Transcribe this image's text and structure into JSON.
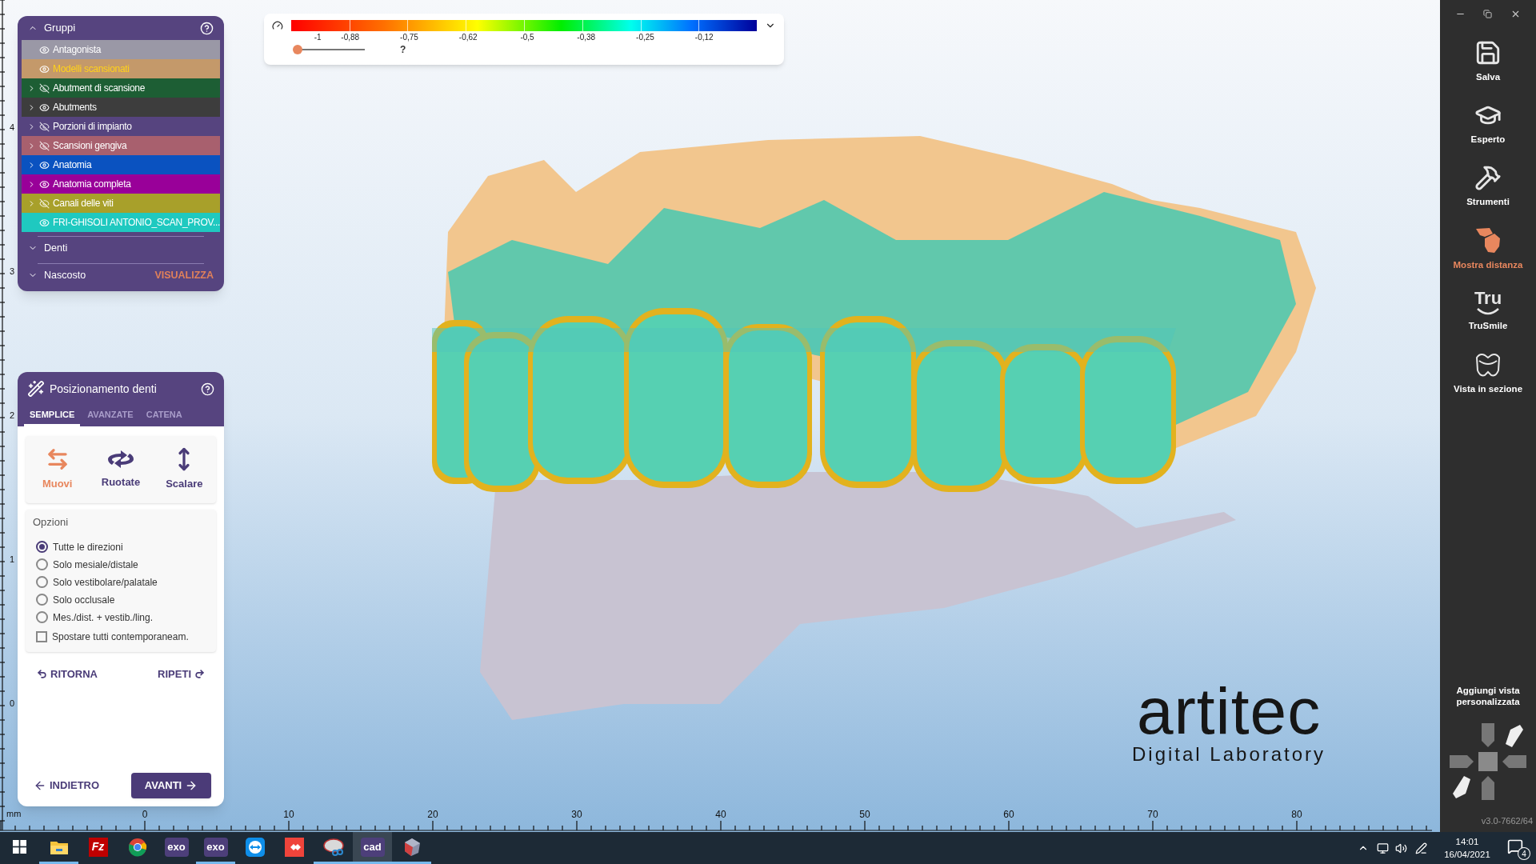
{
  "groups_panel": {
    "title": "Gruppi",
    "expanded": true,
    "items": [
      {
        "label": "Antagonista",
        "visible": true,
        "has_children": false,
        "active": false,
        "color": "#9a98a6"
      },
      {
        "label": "Modelli scansionati",
        "visible": true,
        "has_children": false,
        "active": true,
        "color": "#c4996a"
      },
      {
        "label": "Abutment di scansione",
        "visible": false,
        "has_children": true,
        "active": false,
        "color": "#1d5e34"
      },
      {
        "label": "Abutments",
        "visible": true,
        "has_children": true,
        "active": false,
        "color": "#3d3d3d"
      },
      {
        "label": "Porzioni di impianto",
        "visible": false,
        "has_children": true,
        "active": false,
        "color": "#56447f"
      },
      {
        "label": "Scansioni gengiva",
        "visible": false,
        "has_children": true,
        "active": false,
        "color": "#a8606e"
      },
      {
        "label": "Anatomia",
        "visible": true,
        "has_children": true,
        "active": false,
        "color": "#0a52c0"
      },
      {
        "label": "Anatomia completa",
        "visible": true,
        "has_children": true,
        "active": false,
        "color": "#990099"
      },
      {
        "label": "Canali delle viti",
        "visible": false,
        "has_children": true,
        "active": false,
        "color": "#a8a02a"
      },
      {
        "label": "FRI-GHISOLI ANTONIO_SCAN_PROV...",
        "visible": true,
        "has_children": false,
        "active": false,
        "color": "#1fc9c0"
      }
    ],
    "sections": [
      {
        "label": "Denti",
        "expanded": false
      },
      {
        "label": "Nascosto",
        "expanded": false,
        "action": "VISUALIZZA"
      }
    ]
  },
  "color_scale": {
    "ticks": [
      "-1",
      "-0,88",
      "-0,75",
      "-0,62",
      "-0,5",
      "-0,38",
      "-0,25",
      "-0,12"
    ],
    "slider": {
      "level": 0
    },
    "help": "?"
  },
  "positioning_panel": {
    "title": "Posizionamento denti",
    "tabs": [
      {
        "label": "SEMPLICE",
        "selected": true
      },
      {
        "label": "AVANZATE",
        "selected": false
      },
      {
        "label": "CATENA",
        "selected": false
      }
    ],
    "tools": [
      {
        "label": "Muovi",
        "kind": "move",
        "selected": true
      },
      {
        "label": "Ruotate",
        "kind": "rotate",
        "selected": false
      },
      {
        "label": "Scalare",
        "kind": "scale",
        "selected": false
      }
    ],
    "options": {
      "title": "Opzioni",
      "radios": [
        {
          "label": "Tutte le direzioni",
          "selected": true
        },
        {
          "label": "Solo mesiale/distale",
          "selected": false
        },
        {
          "label": "Solo vestibolare/palatale",
          "selected": false
        },
        {
          "label": "Solo occlusale",
          "selected": false
        },
        {
          "label": "Mes./dist. + vestib./ling.",
          "selected": false
        }
      ],
      "checkbox": {
        "label": "Spostare tutti contemporaneam.",
        "checked": false
      }
    },
    "undo": "RITORNA",
    "redo": "RIPETI",
    "back": "INDIETRO",
    "next": "AVANTI"
  },
  "rulers": {
    "vertical": [
      "4",
      "3",
      "2",
      "1",
      "0"
    ],
    "unit": "mm",
    "horizontal": [
      "0",
      "10",
      "20",
      "30",
      "40",
      "50",
      "60",
      "70",
      "80"
    ]
  },
  "logo": {
    "brand": "artitec",
    "tagline": "Digital Laboratory"
  },
  "sidebar": {
    "items": [
      {
        "label": "Salva",
        "kind": "save",
        "selected": false
      },
      {
        "label": "Esperto",
        "kind": "expert",
        "selected": false
      },
      {
        "label": "Strumenti",
        "kind": "tools",
        "selected": false
      },
      {
        "label": "Mostra distanza",
        "kind": "distance",
        "selected": true
      },
      {
        "label": "TruSmile",
        "kind": "trusmile",
        "icon_text": "Tru",
        "selected": false
      },
      {
        "label": "Vista in sezione",
        "kind": "section",
        "selected": false
      }
    ],
    "custom_view": "Aggiungi vista personalizzata",
    "version": "v3.0-7662/64"
  },
  "taskbar": {
    "apps": [
      {
        "kind": "start",
        "running": false,
        "selected": false
      },
      {
        "kind": "folder",
        "running": true,
        "selected": false
      },
      {
        "kind": "filezilla",
        "label": "Fz",
        "running": false,
        "selected": false
      },
      {
        "kind": "chrome",
        "running": false,
        "selected": false
      },
      {
        "kind": "exo",
        "label": "exo",
        "running": false,
        "selected": false
      },
      {
        "kind": "exo",
        "label": "exo",
        "running": true,
        "selected": false
      },
      {
        "kind": "teamviewer",
        "running": false,
        "selected": false
      },
      {
        "kind": "anydesk",
        "running": false,
        "selected": false
      },
      {
        "kind": "snip",
        "running": true,
        "selected": false
      },
      {
        "kind": "cad",
        "label": "cad",
        "running": true,
        "selected": true
      },
      {
        "kind": "gem",
        "running": true,
        "selected": false
      }
    ],
    "time": "14:01",
    "date": "16/04/2021",
    "notifications": "4"
  }
}
